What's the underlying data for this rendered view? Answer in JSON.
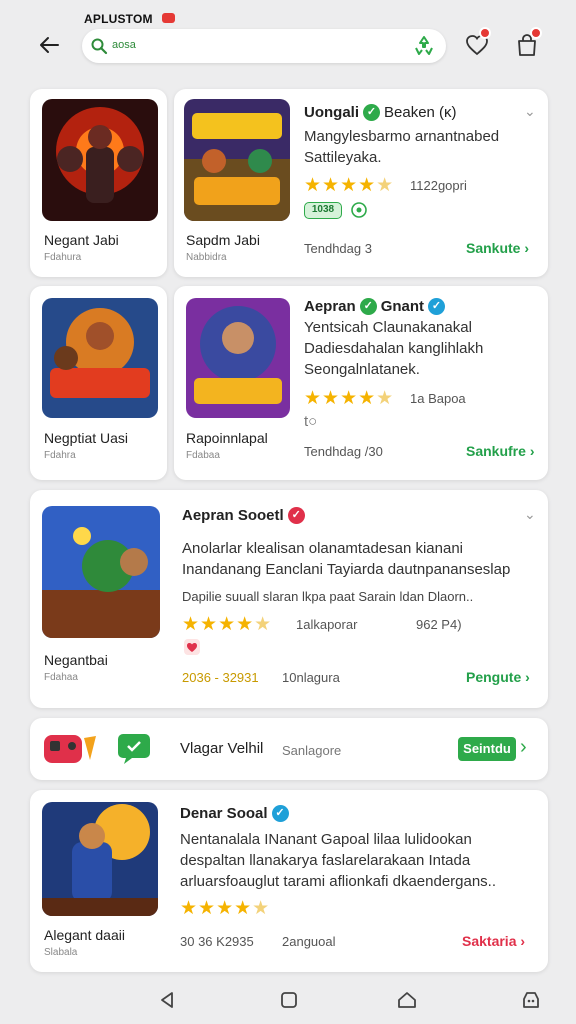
{
  "top": {
    "app_label": "APLUSTOM",
    "search_placeholder": "aosa"
  },
  "cards": [
    {
      "left_name": "Negant Jabi",
      "left_sub": "Fdahura",
      "mid_name": "Sapdm Jabi",
      "mid_sub": "Nabbidra",
      "title": "Uongali",
      "title_badge": "Beaken (κ)",
      "desc_lines": [
        "Mangylesbarmo arnantnabed",
        "Sattileyaka."
      ],
      "rating_text": "1122gopri",
      "tag": "1038",
      "meta": "Tendhdag 3",
      "action": "Sankute",
      "rating": 4.5
    },
    {
      "left_name": "Negptiat Uasi",
      "left_sub": "Fdahra",
      "mid_name": "Rapoinnlapal",
      "mid_sub": "Fdabaa",
      "title": "Aepran",
      "title_badge": "Gnant",
      "desc_lines": [
        "Yentsicah Claunakanakal",
        "Dadiesdahalan kanglihlakh",
        "Seongalnlatanek."
      ],
      "rating_text": "1a Bapoa",
      "meta_icon": "t○",
      "meta": "Tendhdag /30",
      "action": "Sankufre",
      "rating": 4.5
    },
    {
      "left_name": "Negantbai",
      "left_sub": "Fdahaa",
      "title": "Aepran Sooetl",
      "desc_lines": [
        "Anolarlar klealisan olanamtadesan kianani",
        "Inandanang Eanclani Tayiarda dautnpananseslap"
      ],
      "desc_small": "Dapilie suuall slaran lkpa paat Sarain ldan Dlaorn..",
      "rating_text": "1alkaporar",
      "rating_text2": "962 P4)",
      "meta": "2036 - 32931",
      "meta2": "10nlagura",
      "action": "Pengute",
      "rating": 4.5
    },
    {
      "title": "Vlagar Velhil",
      "sub": "Sanlagore",
      "button": "Seintdu"
    },
    {
      "left_name": "Alegant daaii",
      "left_sub": "Slabala",
      "title": "Denar Sooal",
      "desc_lines": [
        "Nentanalala INanant Gapoal lilaa lulidookan",
        "despaltan llanakarya faslarelarakaan Intada",
        "arluarsfoauglut tarami aflionkafi dkaendergans.."
      ],
      "meta": "30 36 K2935",
      "meta2": "2anguoal",
      "action": "Saktaria",
      "rating": 4.5
    }
  ],
  "colors": {
    "background": "#ededee",
    "accent_green": "#23a04a",
    "star": "#f5b301",
    "badge_red": "#e53935",
    "verified_blue": "#1fa0d8"
  },
  "icons": {
    "back": "arrow-left-icon",
    "search": "search-icon",
    "filter": "recycle-icon",
    "heart": "heart-icon",
    "bag": "shopping-bag-icon",
    "verified": "check-badge-icon",
    "nav_back": "triangle-back-icon",
    "nav_home": "square-home-icon",
    "nav_recent": "house-icon",
    "nav_assistant": "face-icon"
  }
}
